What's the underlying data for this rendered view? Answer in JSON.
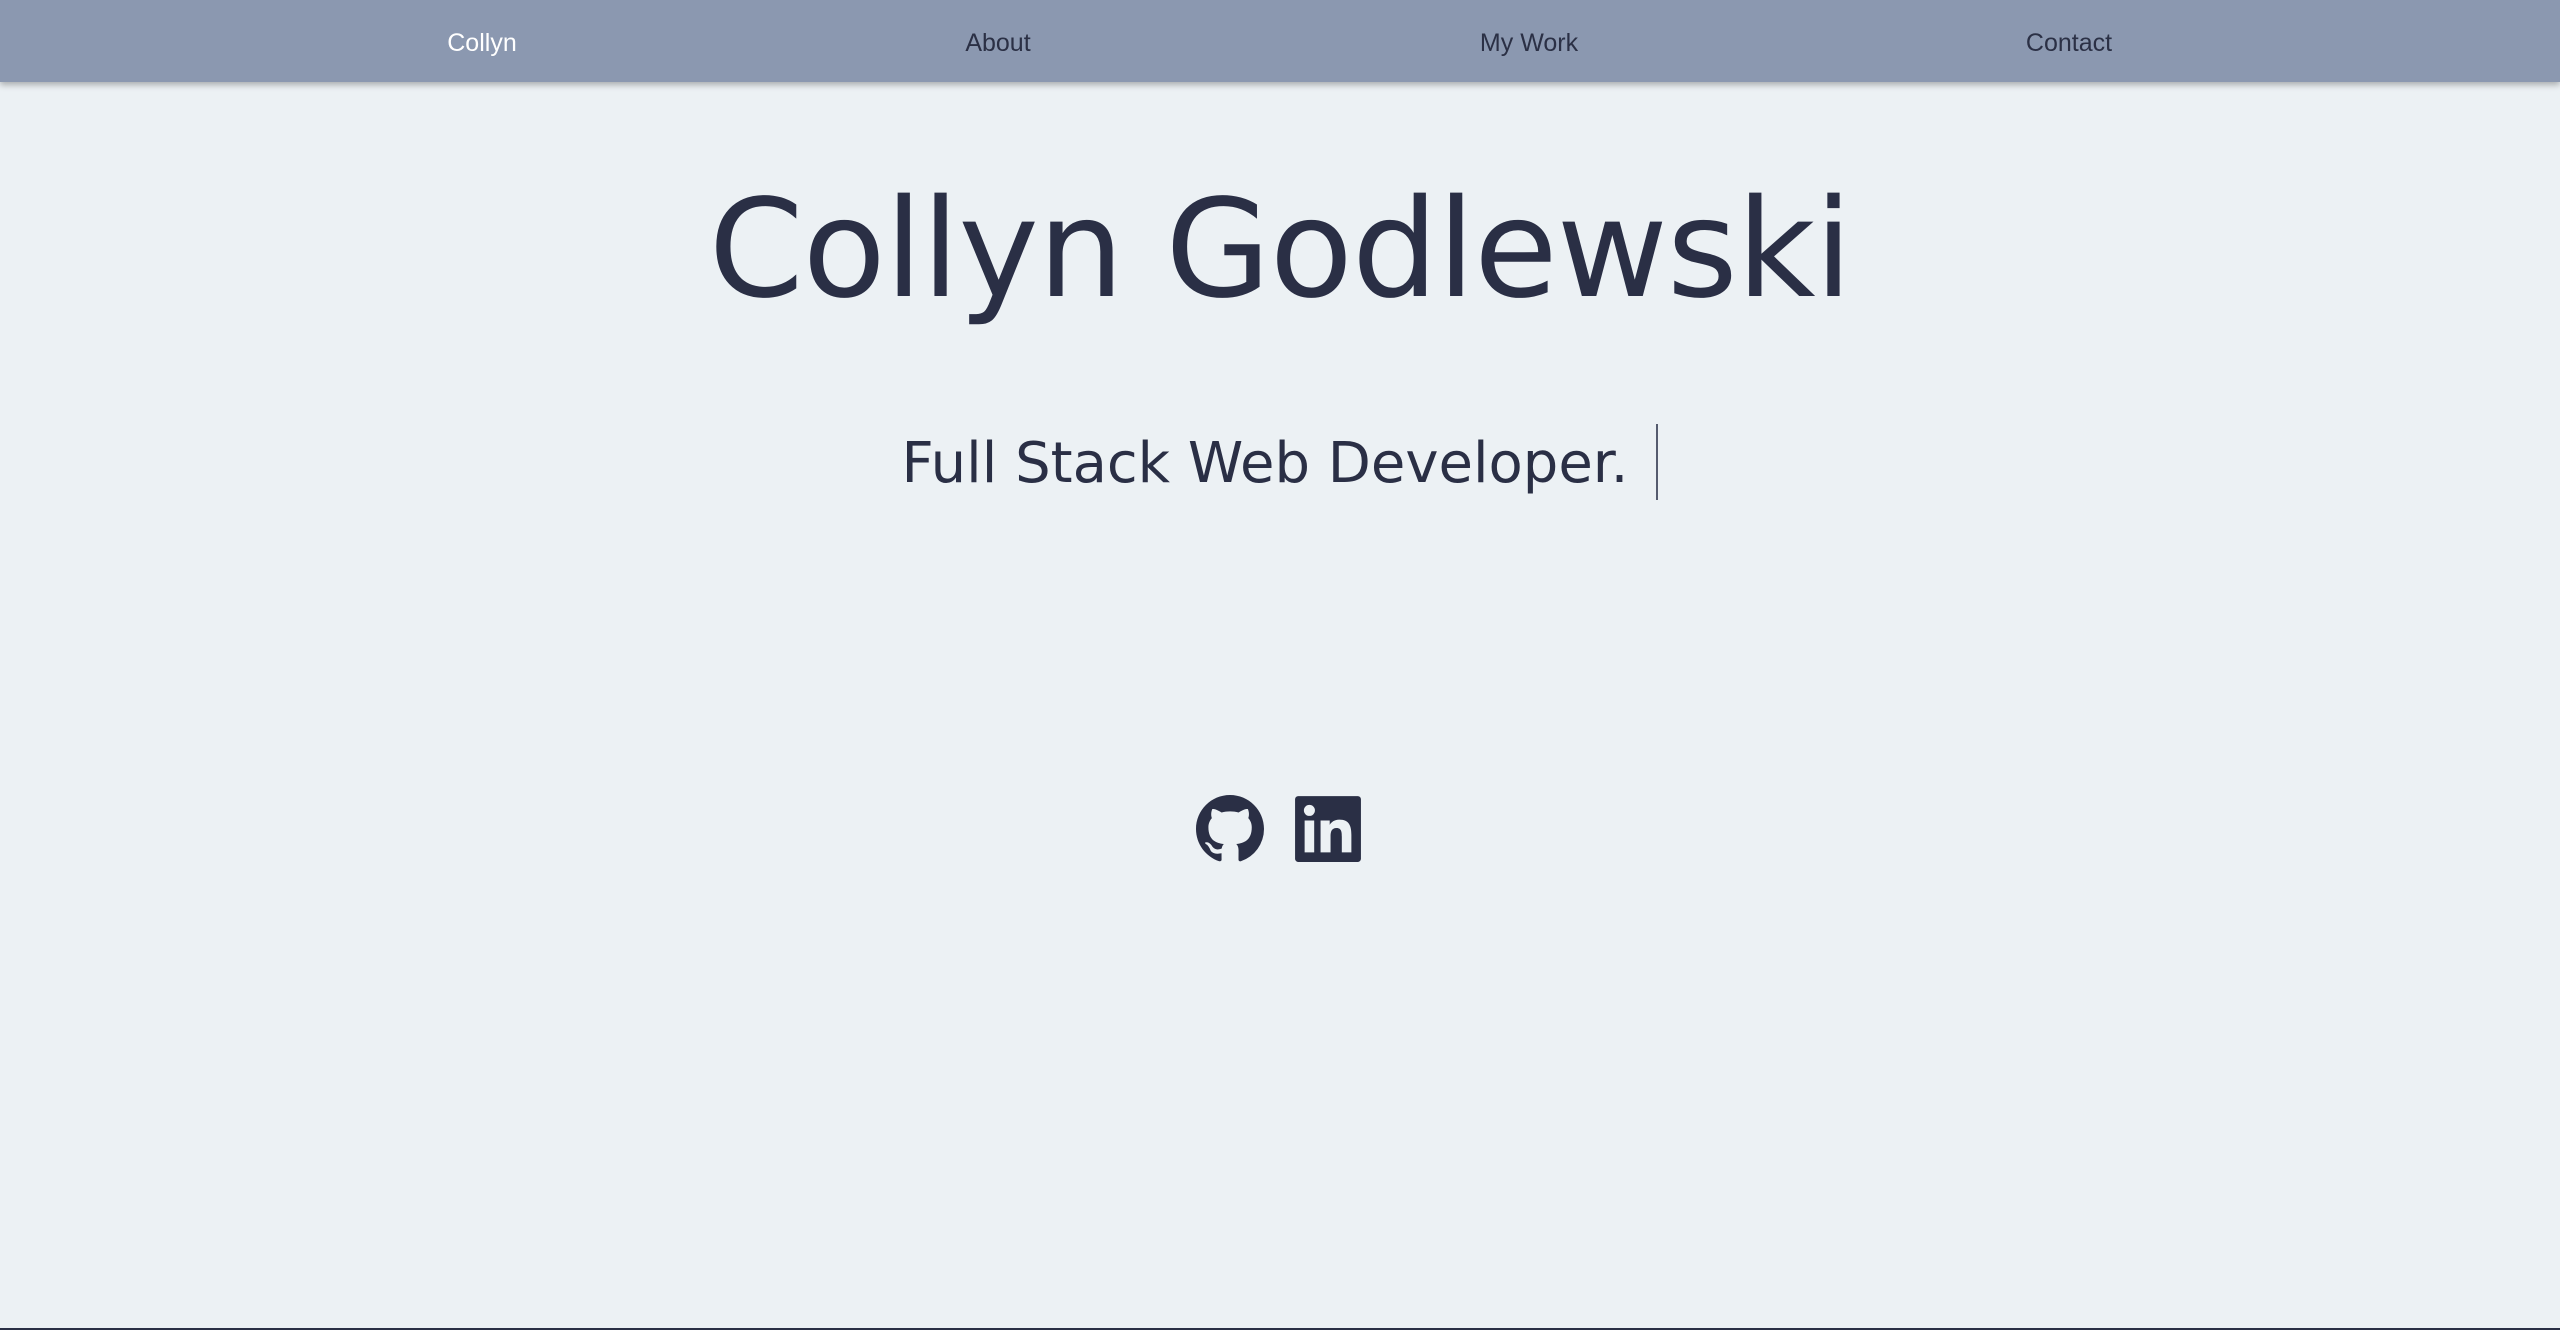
{
  "nav": {
    "brand": "Collyn",
    "items": [
      {
        "label": "About"
      },
      {
        "label": "My Work"
      },
      {
        "label": "Contact"
      }
    ]
  },
  "hero": {
    "name": "Collyn Godlewski",
    "tagline": "Full Stack Web Developer."
  },
  "social": {
    "github_icon": "github-icon",
    "linkedin_icon": "linkedin-icon"
  },
  "colors": {
    "navbar": "#8B98B0",
    "background": "#ECF1F4",
    "text": "#2A2F45",
    "brand": "#FFFFFF"
  }
}
